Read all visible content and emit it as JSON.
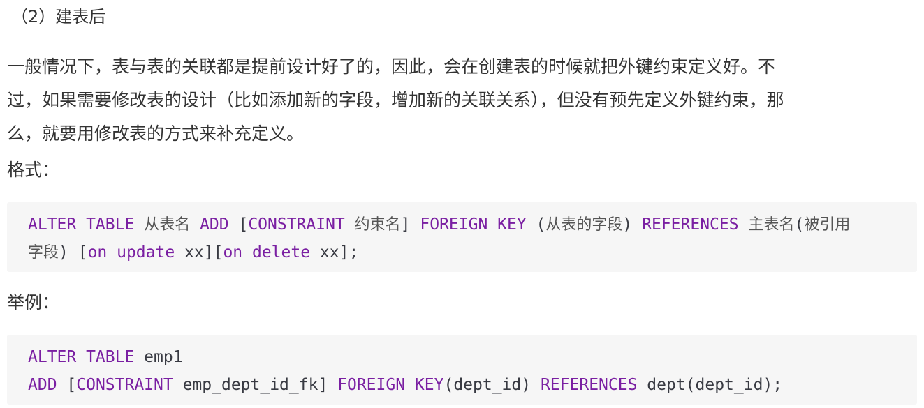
{
  "heading": "（2）建表后",
  "paragraph": {
    "lines": [
      "一般情况下，表与表的关联都是提前设计好了的，因此，会在创建表的时候就把外键约束定义好。不",
      "过，如果需要修改表的设计（比如添加新的字段，增加新的关联关系），但没有预先定义外键约束，那",
      "么，就要用修改表的方式来补充定义。"
    ]
  },
  "format_label": "格式：",
  "format_code": {
    "line1": [
      {
        "t": "ALTER TABLE",
        "k": "kw"
      },
      {
        "t": " ",
        "k": ""
      },
      {
        "t": "从表名",
        "k": "cjk"
      },
      {
        "t": " ",
        "k": ""
      },
      {
        "t": "ADD",
        "k": "kw"
      },
      {
        "t": " [",
        "k": ""
      },
      {
        "t": "CONSTRAINT",
        "k": "kw"
      },
      {
        "t": " ",
        "k": ""
      },
      {
        "t": "约束名",
        "k": "cjk"
      },
      {
        "t": "] ",
        "k": ""
      },
      {
        "t": "FOREIGN KEY",
        "k": "kw"
      },
      {
        "t": " (",
        "k": ""
      },
      {
        "t": "从表的字段",
        "k": "cjk"
      },
      {
        "t": ") ",
        "k": ""
      },
      {
        "t": "REFERENCES",
        "k": "kw"
      },
      {
        "t": " ",
        "k": ""
      },
      {
        "t": "主表名",
        "k": "cjk"
      },
      {
        "t": "(",
        "k": ""
      },
      {
        "t": "被引用",
        "k": "cjk"
      }
    ],
    "line2": [
      {
        "t": "字段",
        "k": "cjk"
      },
      {
        "t": ") [",
        "k": ""
      },
      {
        "t": "on update",
        "k": "kw"
      },
      {
        "t": " xx][",
        "k": ""
      },
      {
        "t": "on delete",
        "k": "kw"
      },
      {
        "t": " xx];",
        "k": ""
      }
    ]
  },
  "example_label": "举例：",
  "example_code": {
    "line1": [
      {
        "t": "ALTER TABLE",
        "k": "kw"
      },
      {
        "t": " emp1",
        "k": ""
      }
    ],
    "line2": [
      {
        "t": "ADD",
        "k": "kw"
      },
      {
        "t": " [",
        "k": ""
      },
      {
        "t": "CONSTRAINT",
        "k": "kw"
      },
      {
        "t": " emp_dept_id_fk] ",
        "k": ""
      },
      {
        "t": "FOREIGN KEY",
        "k": "kw"
      },
      {
        "t": "(dept_id) ",
        "k": ""
      },
      {
        "t": "REFERENCES",
        "k": "kw"
      },
      {
        "t": " dept(dept_id);",
        "k": ""
      }
    ]
  },
  "colors": {
    "keyword": "#7a1fa2",
    "text": "#333333",
    "code_bg": "#f6f6f6"
  }
}
